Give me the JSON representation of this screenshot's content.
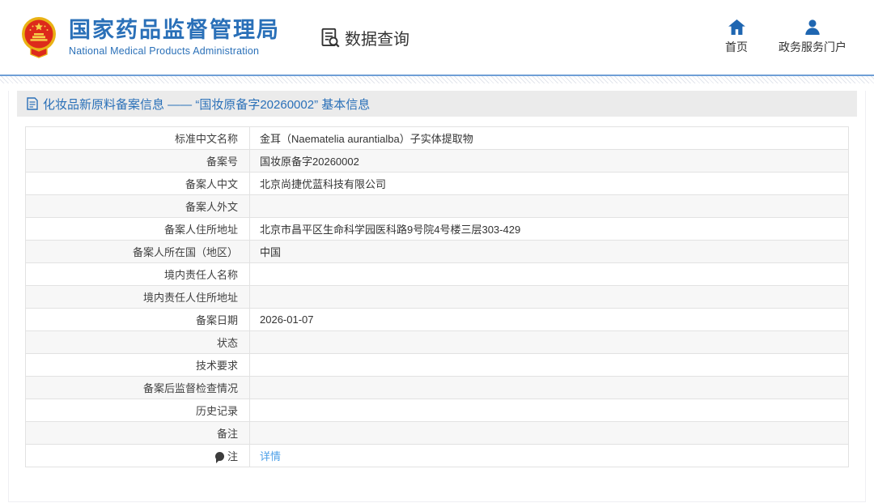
{
  "header": {
    "brand_title_cn": "国家药品监督管理局",
    "brand_title_en": "National Medical Products Administration",
    "section_label": "数据查询",
    "nav": [
      {
        "label": "首页"
      },
      {
        "label": "政务服务门户"
      }
    ]
  },
  "page": {
    "title": "化妆品新原料备案信息 —— “国妆原备字20260002” 基本信息"
  },
  "table": {
    "rows": [
      {
        "label": "标准中文名称",
        "value": "金耳（Naematelia aurantialba）子实体提取物"
      },
      {
        "label": "备案号",
        "value": "国妆原备字20260002"
      },
      {
        "label": "备案人中文",
        "value": "北京尚捷优蓝科技有限公司"
      },
      {
        "label": "备案人外文",
        "value": ""
      },
      {
        "label": "备案人住所地址",
        "value": "北京市昌平区生命科学园医科路9号院4号楼三层303-429"
      },
      {
        "label": "备案人所在国（地区）",
        "value": "中国"
      },
      {
        "label": "境内责任人名称",
        "value": ""
      },
      {
        "label": "境内责任人住所地址",
        "value": ""
      },
      {
        "label": "备案日期",
        "value": "2026-01-07"
      },
      {
        "label": "状态",
        "value": ""
      },
      {
        "label": "技术要求",
        "value": ""
      },
      {
        "label": "备案后监督检查情况",
        "value": ""
      },
      {
        "label": "历史记录",
        "value": ""
      },
      {
        "label": "备注",
        "value": ""
      },
      {
        "label": "注",
        "value": "详情",
        "link": true,
        "note_icon": true
      }
    ]
  },
  "colors": {
    "brand_blue": "#2a70b8",
    "divider_blue": "#6f9fd6",
    "link_blue": "#4da0e8",
    "titlebar_bg": "#ebebeb",
    "row_alt_bg": "#f7f7f7",
    "table_border": "#e2e2e2",
    "emblem_red": "#dd2a1b",
    "emblem_gold": "#e9b214"
  }
}
